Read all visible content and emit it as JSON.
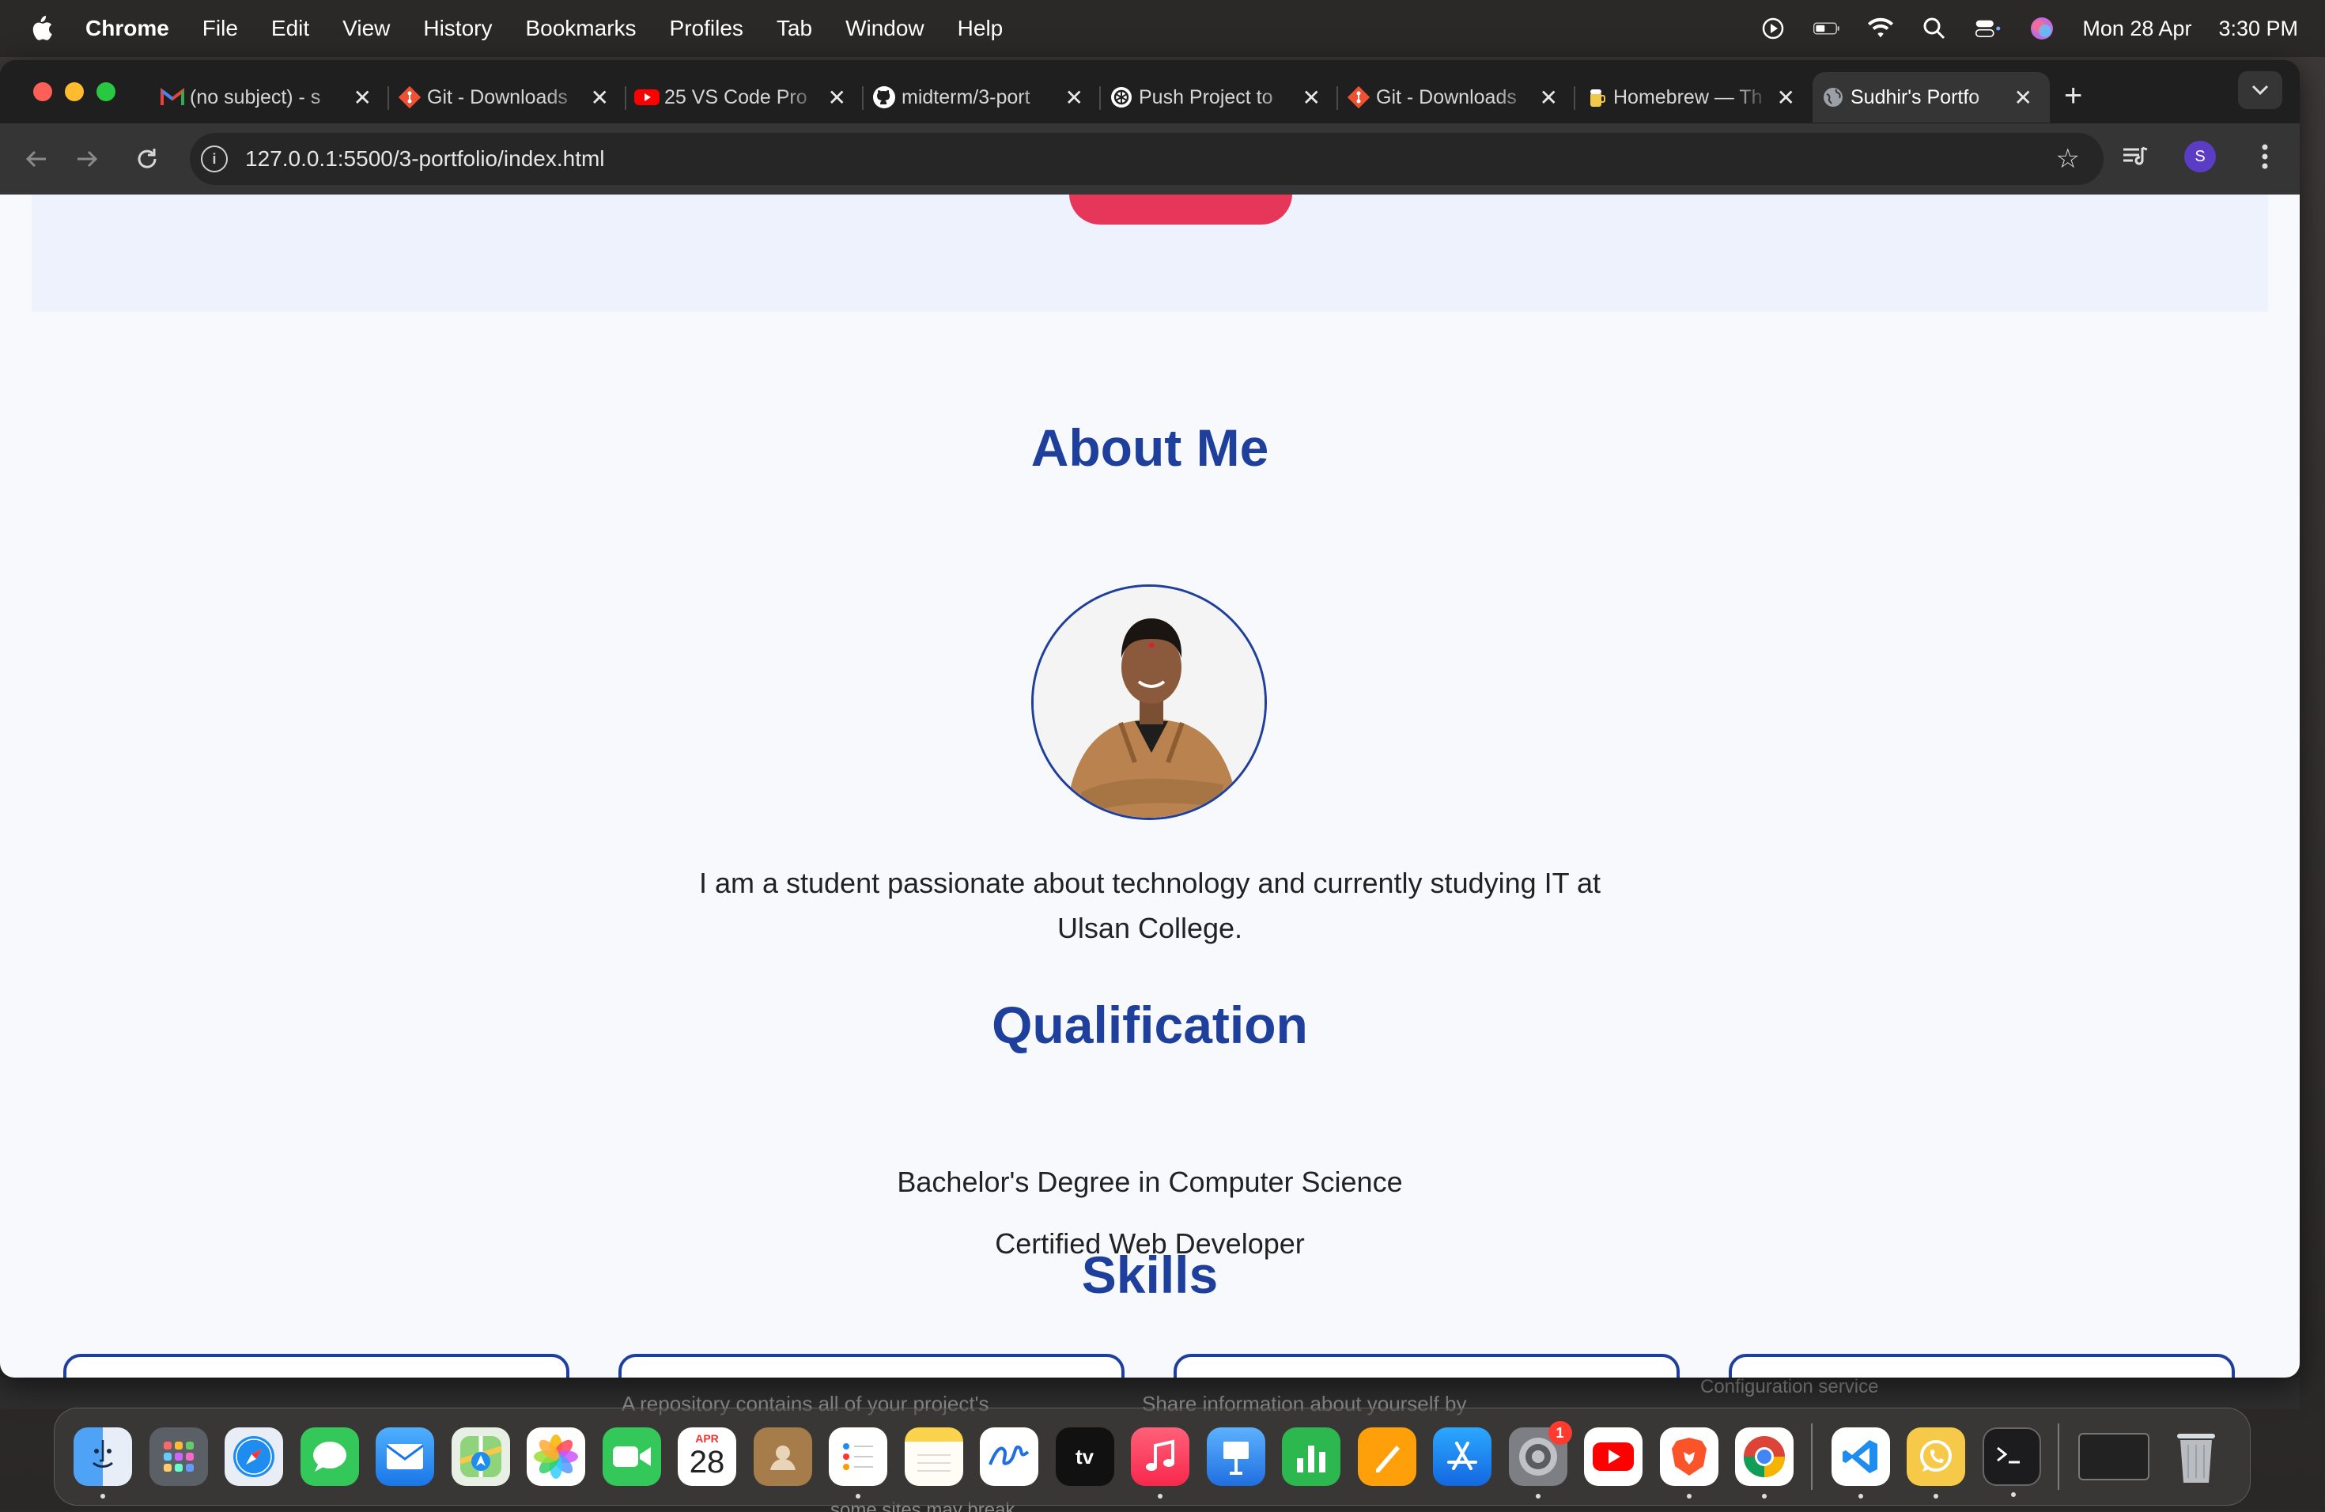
{
  "menubar": {
    "app_name": "Chrome",
    "items": [
      "File",
      "Edit",
      "View",
      "History",
      "Bookmarks",
      "Profiles",
      "Tab",
      "Window",
      "Help"
    ],
    "date": "Mon 28 Apr",
    "time": "3:30 PM"
  },
  "tabs": [
    {
      "title": "(no subject) - s",
      "favicon": "gmail-icon",
      "color": "#ffffff"
    },
    {
      "title": "Git - Downloads",
      "favicon": "git-icon",
      "color": "#f05133"
    },
    {
      "title": "25 VS Code Pro",
      "favicon": "youtube-icon",
      "color": "#ff0000"
    },
    {
      "title": "midterm/3-port",
      "favicon": "github-icon",
      "color": "#ffffff"
    },
    {
      "title": "Push Project to",
      "favicon": "chatgpt-icon",
      "color": "#ffffff"
    },
    {
      "title": "Git - Downloads",
      "favicon": "git-icon",
      "color": "#f05133"
    },
    {
      "title": "Homebrew — Th",
      "favicon": "homebrew-icon",
      "color": "#f2c84b"
    },
    {
      "title": "Sudhir's Portfo",
      "favicon": "globe-icon",
      "color": "#9aa0a6",
      "active": true
    }
  ],
  "address_bar": {
    "url": "127.0.0.1:5500/3-portfolio/index.html"
  },
  "profile_initial": "S",
  "page": {
    "about": {
      "title": "About Me",
      "text": "I am a student passionate about technology and currently studying IT at Ulsan College."
    },
    "qualification": {
      "title": "Qualification",
      "items": [
        "Bachelor's Degree in Computer Science",
        "Certified Web Developer"
      ]
    },
    "skills": {
      "title": "Skills"
    }
  },
  "behind_window": {
    "text_left": "A repository contains all of your project's",
    "text_mid": "Share information about yourself by",
    "text_right": "Configuration service",
    "text_bottom": "some sites may break"
  },
  "dock": {
    "calendar_month": "APR",
    "calendar_day": "28",
    "settings_badge": "1",
    "apple_tv_label": "tv"
  },
  "colors": {
    "accent_blue": "#1f3f9c",
    "hero_button": "#e6365a",
    "page_bg": "#f7f9fc",
    "hero_bg": "#eef2fc"
  }
}
